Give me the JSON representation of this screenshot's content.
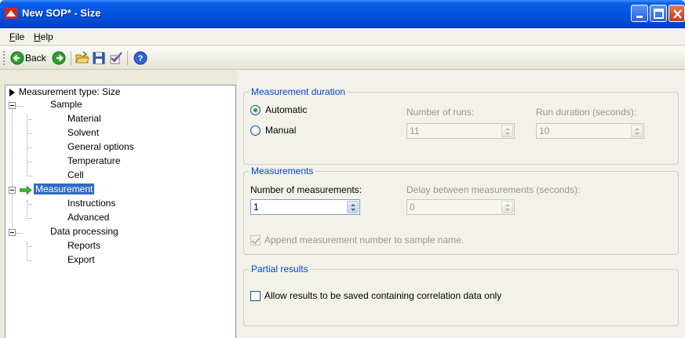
{
  "window": {
    "title": "New SOP* - Size",
    "controls": {
      "minimize": "minimize",
      "maximize": "maximize",
      "close": "close"
    }
  },
  "menu": {
    "file": "File",
    "file_mnemonic": "F",
    "file_rest": "ile",
    "help": "Help",
    "help_mnemonic": "H",
    "help_rest": "elp"
  },
  "toolbar": {
    "back_label": "Back",
    "icons": [
      "back-arrow-icon",
      "forward-arrow-icon",
      "open-folder-icon",
      "save-disk-icon",
      "edit-check-icon",
      "help-icon"
    ]
  },
  "tree": {
    "root": "Measurement type: Size",
    "sample": "Sample",
    "sample_children": [
      "Material",
      "Solvent",
      "General options",
      "Temperature",
      "Cell"
    ],
    "measurement": "Measurement",
    "measurement_children": [
      "Instructions",
      "Advanced"
    ],
    "data_processing": "Data processing",
    "data_processing_children": [
      "Reports",
      "Export"
    ]
  },
  "measurement_duration": {
    "legend": "Measurement duration",
    "automatic_label": "Automatic",
    "manual_label": "Manual",
    "selected": "Automatic",
    "runs_label": "Number of runs:",
    "runs_value": "11",
    "run_duration_label": "Run duration (seconds):",
    "run_duration_value": "10"
  },
  "measurements": {
    "legend": "Measurements",
    "count_label": "Number of measurements:",
    "count_value": "1",
    "delay_label": "Delay between measurements (seconds):",
    "delay_value": "0",
    "append_label": "Append measurement number to sample name.",
    "append_checked": true
  },
  "partial_results": {
    "legend": "Partial results",
    "allow_label": "Allow results to be saved containing correlation data only",
    "allow_checked": false
  },
  "colors": {
    "titlebar": "#0254df",
    "selection": "#316ac5",
    "legend_text": "#0046d5",
    "radio_dot": "#21a121"
  }
}
